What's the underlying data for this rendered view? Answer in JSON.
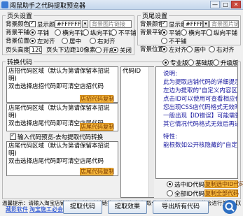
{
  "window": {
    "title": "闯鼠助手之代码提取预览器",
    "minimize": "—",
    "maximize": "□",
    "close": "✕"
  },
  "head": {
    "legend": "页头设置",
    "bg_color_label": "背景颜色:",
    "show_color_label": "显示颜色",
    "color_value": "#FFFFFF",
    "bg_image_placeholder": "背景图片链接",
    "bg_tile_label": "背景平铺:",
    "tile_options": [
      "平铺",
      "横向平铺",
      "纵向平铺",
      "不平铺"
    ],
    "bg_pos_label": "背景位置:",
    "pos_options": [
      "左对齐",
      "居中",
      "右对齐"
    ],
    "height_label": "页头高度:",
    "height_value": "120",
    "spacing_label": "页头下边距10像素:",
    "spacing_options": [
      "开启",
      "关闭"
    ]
  },
  "tail": {
    "legend": "页尾设置",
    "bg_color_label": "背景颜色:",
    "show_color_label": "显示颜色",
    "color_value": "#FFFFFF",
    "bg_image_placeholder": "背景图片链接",
    "bg_tile_label": "背景平铺:",
    "tile_options": [
      "平铺",
      "横向平铺",
      "纵向平铺",
      "不平铺"
    ],
    "bg_pos_label": "背景位置:",
    "pos_options": [
      "左对齐",
      "居中",
      "右对齐"
    ]
  },
  "code": {
    "legend": "转换代码",
    "mode_options": [
      "专业版",
      "基础版",
      "升级版"
    ],
    "shop_header_label": "店招代码区域（默认为第请保留本招说明)",
    "shop_header_text": "双击选择店招代码即可清空店招代码",
    "copy_header_btn": "店招代码复制",
    "shop_tail_label": "店尾代码区域（默认为第请保留本招说明)",
    "shop_tail_text": "双击选择店尾代码即可清空店尾代码",
    "copy_tail_btn": "店尾代码复制",
    "input_toggle": "输入代码预览-去勾提取代码转换",
    "bottom_label": "店尾代码区域（默认为第请保留本招说明)",
    "bottom_text": "双击选择店尾代码即可清空店尾代码",
    "copy_bottom_btn": "店尾代码复制",
    "code_id_label": "代码ID",
    "hint_title": "说明:",
    "hint_lines": [
      "此为提取店铺代码的详细提示框",
      "左边为提取的\"自定义内容区\"代码ID",
      "点击ID可以使用可查看相应代码",
      "您出现CSS店代码格式无效时需要分析CSS",
      "一般出现【ID错误】可能需要分析CSS",
      "其它情况代码格式无效后再进行CSS分析"
    ],
    "hint_extra": "特性:",
    "hint_extra_line": "能根数如公开核隐藏的\"自定义内容区\"代码",
    "id_options": [
      "选中ID代码预览",
      "全部ID代码预览"
    ],
    "copy_id_btn": "复制选中ID代码",
    "copy_all_btn": "复制全部代码"
  },
  "notice": "温馨提示：请输入淘宝店铺的（正确）店铺链接，然后点击\"提取代码\"按钮就可以，系统会进行处理【双击清空（或收藏复制请选）】",
  "footer": {
    "link1": "藏影软件",
    "link2": "淘宝施工必会",
    "extract_btn": "提取代码",
    "preview_btn": "提取效果",
    "export_btn": "导出所有代码"
  }
}
